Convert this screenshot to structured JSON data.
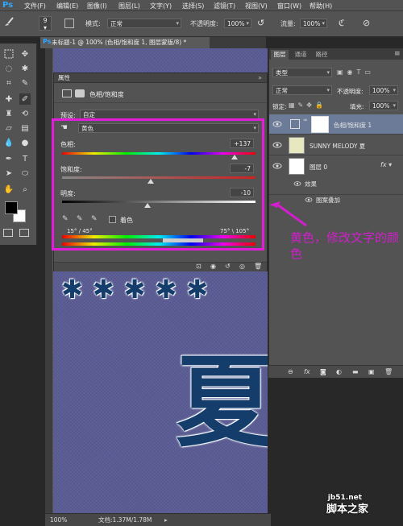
{
  "app": {
    "logo": "Ps"
  },
  "menu": [
    "文件(F)",
    "编辑(E)",
    "图像(I)",
    "图层(L)",
    "文字(Y)",
    "选择(S)",
    "滤镜(T)",
    "视图(V)",
    "窗口(W)",
    "帮助(H)"
  ],
  "options": {
    "brush_size": "9",
    "mode_label": "模式:",
    "mode_value": "正常",
    "opacity_label": "不透明度:",
    "opacity_value": "100%",
    "flow_label": "流量:",
    "flow_value": "100%"
  },
  "document": {
    "tab_title": "未标题-1 @ 100% (色相/饱和度 1, 图层蒙版/8) *",
    "zoom": "100%",
    "doc_size": "文档:1.37M/1.78M"
  },
  "canvas": {
    "big_char": "夏"
  },
  "properties": {
    "title": "属性",
    "adjustment_name": "色相/饱和度",
    "preset_label": "预设:",
    "preset_value": "自定",
    "channel_value": "黄色",
    "hue_label": "色相:",
    "hue_value": "+137",
    "saturation_label": "饱和度:",
    "saturation_value": "-7",
    "lightness_label": "明度:",
    "lightness_value": "-10",
    "colorize_label": "着色",
    "range_left": "15° / 45°",
    "range_right": "75° \\ 105°"
  },
  "callout": {
    "text": "黄色，修改文字的颜色",
    "color": "#d21ecc"
  },
  "layers_panel": {
    "tabs": [
      "图层",
      "通道",
      "路径"
    ],
    "filter_kind": "类型",
    "blend_mode": "正常",
    "opacity_label": "不透明度:",
    "opacity_value": "100%",
    "lock_label": "锁定:",
    "fill_label": "填充:",
    "fill_value": "100%",
    "layers": [
      {
        "name": "色相/饱和度 1"
      },
      {
        "name": "SUNNY MELODY 夏"
      },
      {
        "name": "图层 0"
      }
    ],
    "effects_label": "效果",
    "effect_item": "图案叠加"
  },
  "watermark": {
    "site": "jb51.net",
    "name": "脚本之家"
  }
}
